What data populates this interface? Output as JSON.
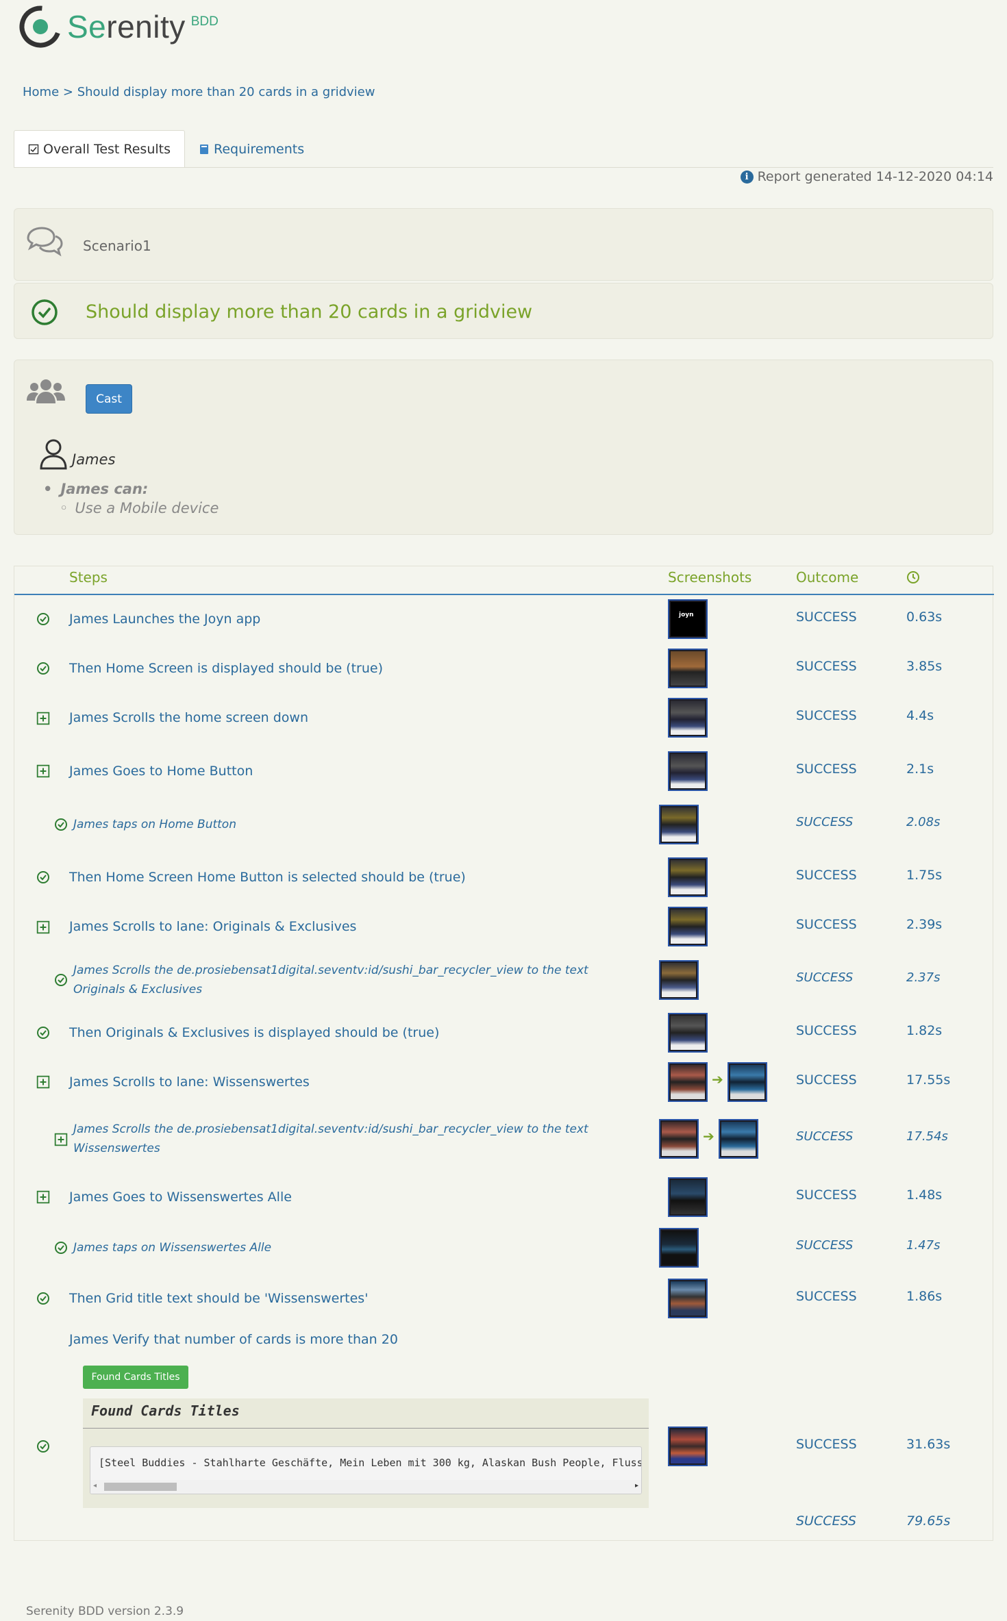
{
  "brand": {
    "name_prefix": "Se",
    "name_rest": "renity",
    "suffix": "BDD"
  },
  "breadcrumb": {
    "home": "Home",
    "separator": ">",
    "current": "Should display more than 20 cards in a gridview"
  },
  "tabs": [
    {
      "label": "Overall Test Results",
      "active": true,
      "icon": "checkbox-icon"
    },
    {
      "label": "Requirements",
      "active": false,
      "icon": "book-icon"
    }
  ],
  "report": {
    "generated": "Report generated 14-12-2020 04:14"
  },
  "scenario": {
    "name": "Scenario1",
    "title": "Should display more than 20 cards in a gridview"
  },
  "cast": {
    "button": "Cast",
    "actor": "James",
    "can_label": "James can:",
    "ability": "Use a Mobile device"
  },
  "table": {
    "headers": {
      "steps": "Steps",
      "screenshots": "Screenshots",
      "outcome": "Outcome"
    },
    "rows": [
      {
        "desc": "James Launches the Joyn app",
        "outcome": "SUCCESS",
        "duration": "0.63s",
        "status": "check"
      },
      {
        "desc": "Then Home Screen is displayed should be (true)",
        "outcome": "SUCCESS",
        "duration": "3.85s",
        "status": "check"
      },
      {
        "desc": "James Scrolls the home screen down",
        "outcome": "SUCCESS",
        "duration": "4.4s",
        "status": "plus"
      },
      {
        "desc": "James Goes to Home Button",
        "outcome": "SUCCESS",
        "duration": "2.1s",
        "status": "plus"
      },
      {
        "desc": "James taps on Home Button",
        "outcome": "SUCCESS",
        "duration": "2.08s",
        "status": "check",
        "sub": true
      },
      {
        "desc": "Then Home Screen Home Button is selected should be (true)",
        "outcome": "SUCCESS",
        "duration": "1.75s",
        "status": "check"
      },
      {
        "desc": "James Scrolls to lane: Originals & Exclusives",
        "outcome": "SUCCESS",
        "duration": "2.39s",
        "status": "plus"
      },
      {
        "desc_line1": "James Scrolls the de.prosiebensat1digital.seventv:id/sushi_bar_recycler_view to the text",
        "desc_line2": "Originals & Exclusives",
        "outcome": "SUCCESS",
        "duration": "2.37s",
        "status": "check",
        "sub": true
      },
      {
        "desc": "Then Originals & Exclusives is displayed should be (true)",
        "outcome": "SUCCESS",
        "duration": "1.82s",
        "status": "check"
      },
      {
        "desc": "James Scrolls to lane: Wissenswertes",
        "outcome": "SUCCESS",
        "duration": "17.55s",
        "status": "plus"
      },
      {
        "desc_line1": "James Scrolls the de.prosiebensat1digital.seventv:id/sushi_bar_recycler_view to the text",
        "desc_line2": "Wissenswertes",
        "outcome": "SUCCESS",
        "duration": "17.54s",
        "status": "plus",
        "sub": true
      },
      {
        "desc": "James Goes to Wissenswertes Alle",
        "outcome": "SUCCESS",
        "duration": "1.48s",
        "status": "plus"
      },
      {
        "desc": "James taps on Wissenswertes Alle",
        "outcome": "SUCCESS",
        "duration": "1.47s",
        "status": "check",
        "sub": true
      },
      {
        "desc": "Then Grid title text should be 'Wissenswertes'",
        "outcome": "SUCCESS",
        "duration": "1.86s",
        "status": "check"
      },
      {
        "desc": "James Verify that number of cards is more than 20",
        "outcome": "SUCCESS",
        "duration": "31.63s",
        "status": "check"
      }
    ],
    "evidence": {
      "button": "Found Cards Titles",
      "title": "Found Cards Titles",
      "content": "[Steel Buddies - Stahlharte Geschäfte, Mein Leben mit 300 kg, Alaskan Bush People, Fluss-"
    },
    "total": {
      "outcome": "SUCCESS",
      "duration": "79.65s"
    }
  },
  "footer": {
    "version": "Serenity BDD version 2.3.9"
  },
  "colors": {
    "accent_green": "#7aa329",
    "link_blue": "#2a6a9c",
    "cast_button": "#3d85c6",
    "evidence_button": "#4cb050"
  }
}
